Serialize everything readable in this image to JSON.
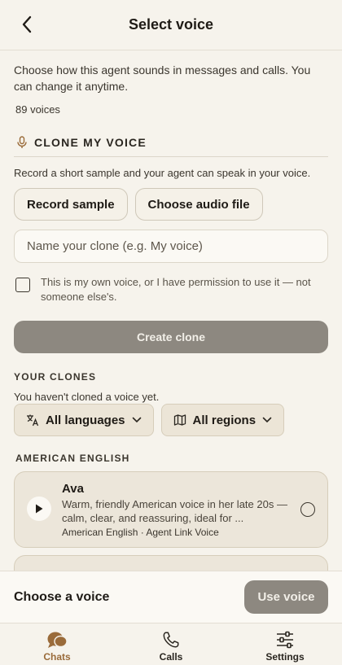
{
  "header": {
    "title": "Select voice"
  },
  "intro": "Choose how this agent sounds in messages and calls. You can change it anytime.",
  "voice_count": "89 voices",
  "clone": {
    "title": "CLONE MY VOICE",
    "description": "Record a short sample and your agent can speak in your voice.",
    "record_label": "Record sample",
    "choose_file_label": "Choose audio file",
    "name_placeholder": "Name your clone (e.g. My voice)",
    "name_value": "",
    "consent_text": "This is my own voice, or I have permission to use it — not someone else's.",
    "create_label": "Create clone"
  },
  "your_clones": {
    "title": "YOUR CLONES",
    "empty_text": "You haven't cloned a voice yet."
  },
  "filters": {
    "language": "All languages",
    "region": "All regions"
  },
  "groups": [
    {
      "title": "AMERICAN ENGLISH",
      "voices": [
        {
          "name": "Ava",
          "description": "Warm, friendly American voice in her late 20s — calm, clear, and reassuring, ideal for ...",
          "meta": "American English · Agent Link Voice"
        }
      ]
    }
  ],
  "bottom": {
    "choose_label": "Choose a voice",
    "use_label": "Use voice"
  },
  "tabs": [
    {
      "label": "Chats",
      "icon": "chat-bubbles-icon"
    },
    {
      "label": "Calls",
      "icon": "phone-icon"
    },
    {
      "label": "Settings",
      "icon": "sliders-icon"
    }
  ],
  "colors": {
    "accent": "#9a6b3a",
    "disabled_button": "#8d8880",
    "background": "#f6f3ec"
  }
}
